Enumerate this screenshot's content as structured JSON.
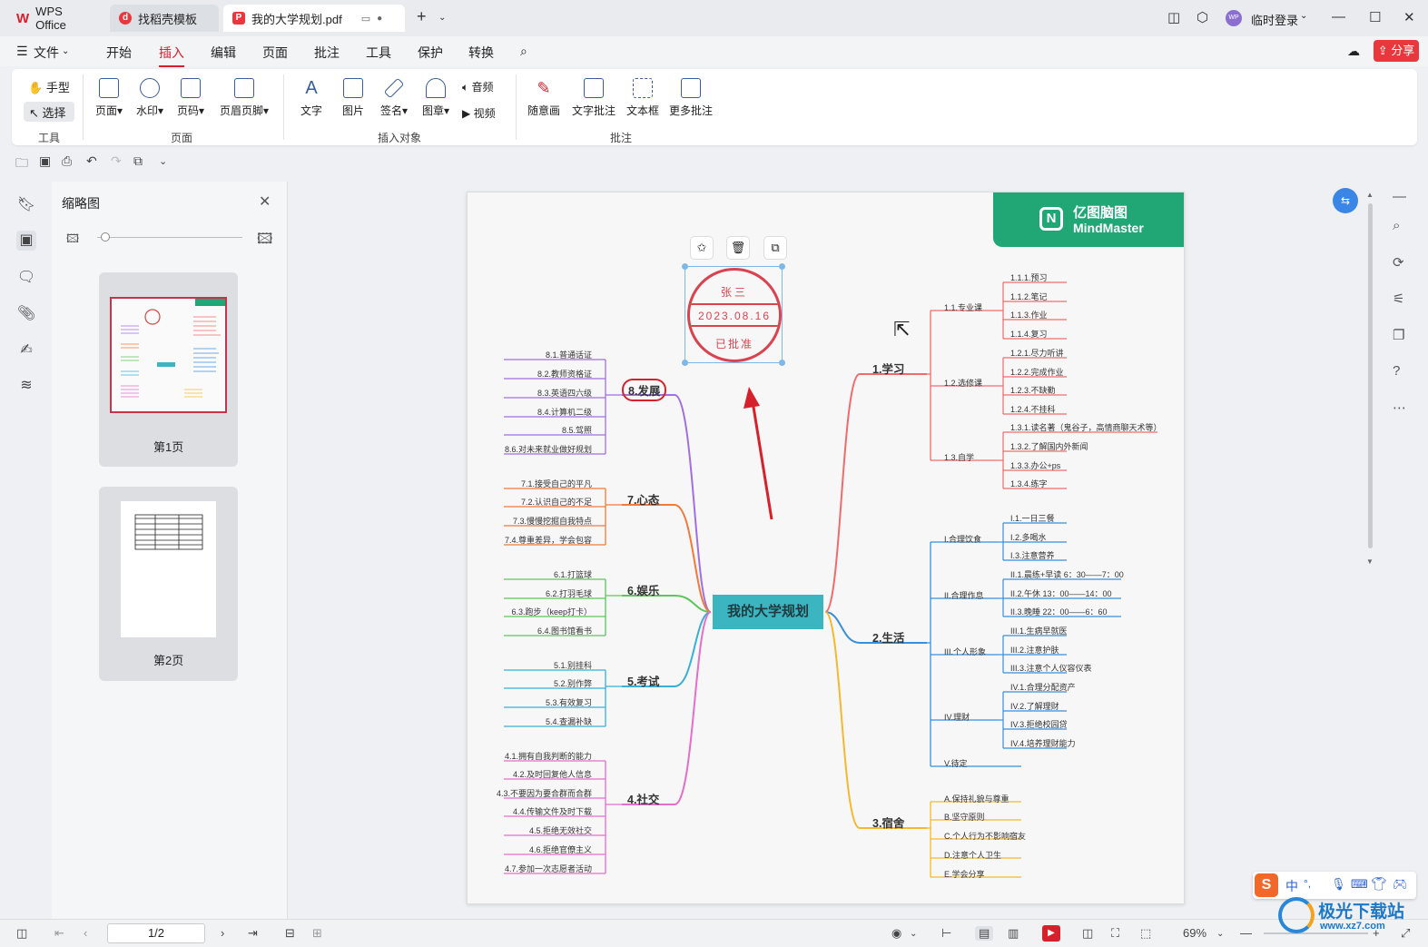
{
  "tabs": [
    {
      "label": "WPS Office"
    },
    {
      "label": "找稻壳模板"
    },
    {
      "label": "我的大学规划.pdf"
    }
  ],
  "user": {
    "avatar_text": "WP",
    "login": "临时登录"
  },
  "menu": {
    "file": "文件",
    "items": [
      "开始",
      "插入",
      "编辑",
      "页面",
      "批注",
      "工具",
      "保护",
      "转换"
    ],
    "active": "插入",
    "share": "分享"
  },
  "ribbon": {
    "tools": {
      "hand": "手型",
      "select": "选择",
      "group": "工具"
    },
    "page_group": {
      "items": [
        "页面",
        "水印",
        "页码",
        "页眉页脚"
      ],
      "group": "页面"
    },
    "insert_group": {
      "items": [
        "文字",
        "图片",
        "签名",
        "图章"
      ],
      "audio": "音频",
      "video": "视频",
      "group": "插入对象"
    },
    "annot_group": {
      "items": [
        "随意画",
        "文字批注",
        "文本框",
        "更多批注"
      ],
      "group": "批注"
    }
  },
  "panel": {
    "title": "缩略图",
    "pages": [
      {
        "label": "第1页"
      },
      {
        "label": "第2页"
      }
    ]
  },
  "statusbar": {
    "page_value": "1/2",
    "zoom": "69%"
  },
  "doc": {
    "brand": {
      "cn": "亿图脑图",
      "en": "MindMaster"
    },
    "stamp": {
      "name": "张三",
      "date": "2023.08.16",
      "status": "已批准"
    },
    "center": "我的大学规划",
    "left": [
      {
        "title": "8.发展",
        "color": "#a070e0",
        "items": [
          "8.1.普通话证",
          "8.2.教师资格证",
          "8.3.英语四六级",
          "8.4.计算机二级",
          "8.5.驾照",
          "8.6.对未来就业做好规划"
        ]
      },
      {
        "title": "7.心态",
        "color": "#f07a3a",
        "items": [
          "7.1.接受自己的平凡",
          "7.2.认识自己的不足",
          "7.3.慢慢挖掘自我特点",
          "7.4.尊重差异，学会包容"
        ]
      },
      {
        "title": "6.娱乐",
        "color": "#5cc65a",
        "items": [
          "6.1.打篮球",
          "6.2.打羽毛球",
          "6.3.跑步（keep打卡）",
          "6.4.图书馆看书"
        ]
      },
      {
        "title": "5.考试",
        "color": "#3aaed8",
        "items": [
          "5.1.别挂科",
          "5.2.别作弊",
          "5.3.有效复习",
          "5.4.查漏补缺"
        ]
      },
      {
        "title": "4.社交",
        "color": "#e46fc8",
        "items": [
          "4.1.拥有自我判断的能力",
          "4.2.及时回复他人信息",
          "4.3.不要因为要合群而合群",
          "4.4.传输文件及时下载",
          "4.5.拒绝无效社交",
          "4.6.拒绝官僚主义",
          "4.7.参加一次志愿者活动"
        ]
      }
    ],
    "right": [
      {
        "title": "1.学习",
        "color": "#ef6b6b",
        "subs": [
          {
            "name": "1.1.专业课",
            "items": [
              "1.1.1.预习",
              "1.1.2.笔记",
              "1.1.3.作业",
              "1.1.4.复习"
            ]
          },
          {
            "name": "1.2.选修课",
            "items": [
              "1.2.1.尽力听讲",
              "1.2.2.完成作业",
              "1.2.3.不缺勤",
              "1.2.4.不挂科"
            ]
          },
          {
            "name": "1.3.自学",
            "items": [
              "1.3.1.读名著（鬼谷子，高情商聊天术等）",
              "1.3.2.了解国内外新闻",
              "1.3.3.办公+ps",
              "1.3.4.练字"
            ]
          }
        ]
      },
      {
        "title": "2.生活",
        "color": "#3a8fdc",
        "subs": [
          {
            "name": "I.合理饮食",
            "items": [
              "I.1.一日三餐",
              "I.2.多喝水",
              "I.3.注意营养"
            ]
          },
          {
            "name": "II.合理作息",
            "items": [
              "II.1.晨练+早读 6：30——7：00",
              "II.2.午休 13：00——14：00",
              "II.3.晚睡 22：00——6：60"
            ]
          },
          {
            "name": "III.个人形象",
            "items": [
              "III.1.生病早就医",
              "III.2.注意护肤",
              "III.3.注意个人仪容仪表"
            ]
          },
          {
            "name": "IV.理财",
            "items": [
              "IV.1.合理分配资产",
              "IV.2.了解理财",
              "IV.3.拒绝校园贷",
              "IV.4.培养理财能力"
            ]
          },
          {
            "name": "V.待定",
            "items": []
          }
        ]
      },
      {
        "title": "3.宿舍",
        "color": "#f5b82e",
        "subs": [
          {
            "name": "A.保持礼貌与尊重",
            "items": []
          },
          {
            "name": "B.坚守原则",
            "items": []
          },
          {
            "name": "C.个人行为不影响宿友",
            "items": []
          },
          {
            "name": "D.注意个人卫生",
            "items": []
          },
          {
            "name": "E.学会分享",
            "items": []
          }
        ]
      }
    ]
  },
  "watermark": {
    "text": "极光下载站",
    "url": "www.xz7.com"
  }
}
